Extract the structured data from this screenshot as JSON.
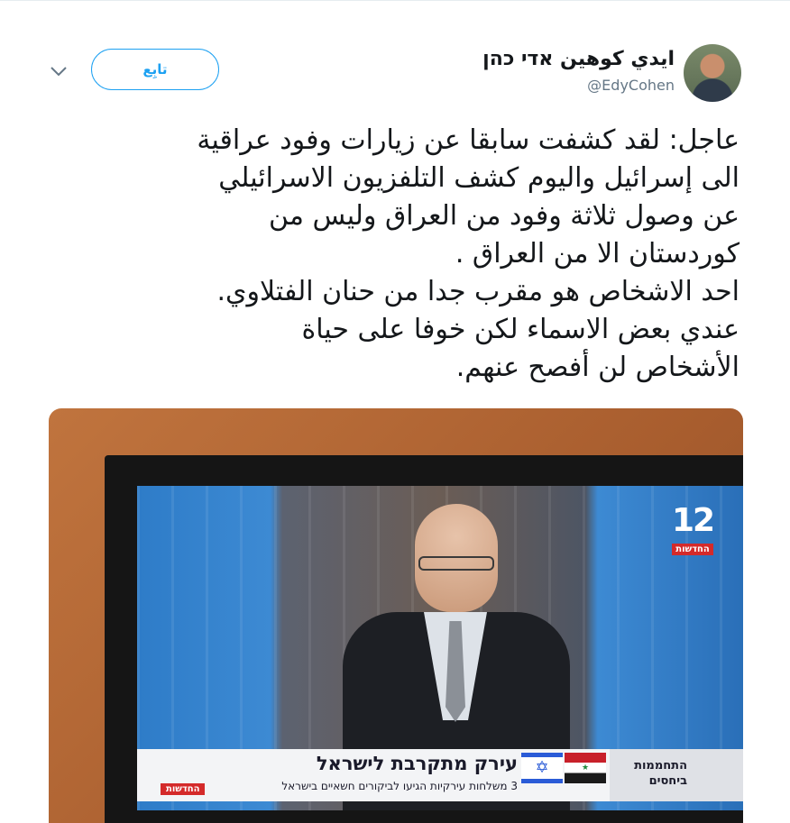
{
  "tweet": {
    "author": {
      "display_name": "ايدي كوهين אדי כהן",
      "handle": "@EdyCohen"
    },
    "follow_label": "تابِع",
    "text": "عاجل: لقد كشفت سابقا عن زيارات وفود عراقية\nالى إسرائيل واليوم كشف التلفزيون الاسرائيلي\nعن وصول ثلاثة وفود من العراق وليس من\nكوردستان الا من العراق .\nاحد الاشخاص هو مقرب جدا من حنان الفتلاوي.\nعندي بعض الاسماء لكن خوفا على حياة\nالأشخاص لن أفصح عنهم."
  },
  "media": {
    "channel_number": "12",
    "channel_label": "החדשות",
    "ticker_headline": "עירק מתקרבת לישראל",
    "ticker_subline": "3 משלחות עירקיות הגיעו לביקורים חשאיים בישראל",
    "ticker_tag": "התחממות ביחסים",
    "ticker_news_label": "החדשות"
  },
  "colors": {
    "accent": "#1da1f2",
    "text": "#14171a",
    "muted": "#657786"
  }
}
